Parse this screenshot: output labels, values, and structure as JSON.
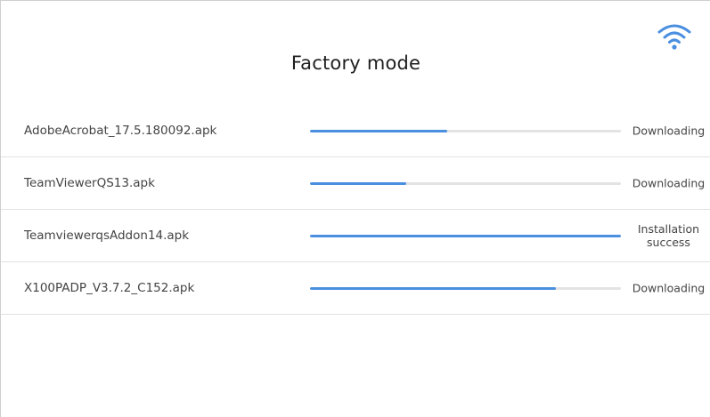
{
  "header": {
    "title": "Factory mode",
    "wifi_icon": "wifi-icon",
    "accent_color": "#4a8fe0"
  },
  "downloads": [
    {
      "file": "AdobeAcrobat_17.5.180092.apk",
      "progress": 0.44,
      "status": "Downloading"
    },
    {
      "file": "TeamViewerQS13.apk",
      "progress": 0.31,
      "status": "Downloading"
    },
    {
      "file": "TeamviewerqsAddon14.apk",
      "progress": 1.0,
      "status": "Installation\nsuccess"
    },
    {
      "file": "X100PADP_V3.7.2_C152.apk",
      "progress": 0.79,
      "status": "Downloading"
    }
  ]
}
